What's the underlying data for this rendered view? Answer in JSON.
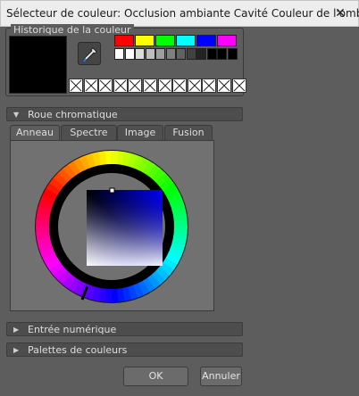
{
  "window": {
    "title": "Sélecteur de couleur: Occlusion ambiante Cavité Couleur de l'ombre",
    "close_glyph": "✕"
  },
  "history": {
    "label": "Historique de la couleur",
    "current_color": "#000000",
    "picker_icon": "eyedropper-icon",
    "swatches_row1": [
      "#ff0000",
      "#ffff00",
      "#00ff00",
      "#00ffff",
      "#0000ff",
      "#ff00ff"
    ],
    "swatches_row2": [
      "#ffffff",
      "#ffffff",
      "#dcdcdc",
      "#bdbdbd",
      "#9e9e9e",
      "#7f7f7f",
      "#616161",
      "#424242",
      "#232323",
      "#000000",
      "#000000",
      "#000000"
    ],
    "empty_slots": 12
  },
  "sections": {
    "color_wheel": "Roue chromatique",
    "numeric_input": "Entrée numérique",
    "palettes": "Palettes de couleurs"
  },
  "tabs": [
    {
      "label": "Anneau",
      "active": true
    },
    {
      "label": "Spectre",
      "active": false
    },
    {
      "label": "Image",
      "active": false
    },
    {
      "label": "Fusion",
      "active": false
    }
  ],
  "wheel": {
    "hue": "#0000ff",
    "selected_marker": "selection-marker"
  },
  "buttons": {
    "ok": "OK",
    "cancel": "Annuler"
  }
}
